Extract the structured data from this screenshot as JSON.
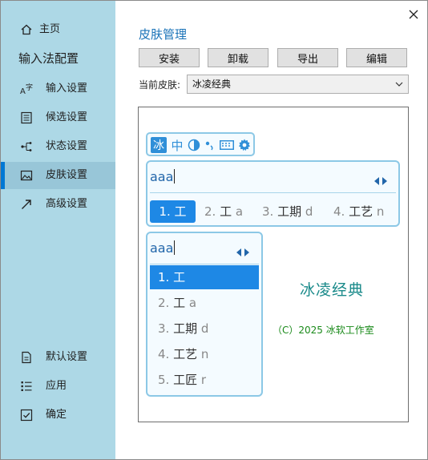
{
  "window": {
    "close_glyph": "✕"
  },
  "sidebar": {
    "home_label": "主页",
    "section_title": "输入法配置",
    "items": [
      {
        "label": "输入设置",
        "icon": "input-settings-icon"
      },
      {
        "label": "候选设置",
        "icon": "candidate-settings-icon"
      },
      {
        "label": "状态设置",
        "icon": "status-settings-icon"
      },
      {
        "label": "皮肤设置",
        "icon": "skin-settings-icon",
        "active": true
      },
      {
        "label": "高级设置",
        "icon": "advanced-settings-icon"
      }
    ],
    "bottom_items": [
      {
        "label": "默认设置",
        "icon": "default-settings-icon"
      },
      {
        "label": "应用",
        "icon": "apply-icon"
      },
      {
        "label": "确定",
        "icon": "confirm-icon"
      }
    ],
    "bg_color": "#add8e6",
    "accent_color": "#0078d4"
  },
  "main": {
    "title": "皮肤管理",
    "buttons": {
      "install": "安装",
      "uninstall": "卸载",
      "export": "导出",
      "edit": "编辑"
    },
    "current_skin_label": "当前皮肤:",
    "current_skin_value": "冰凌经典"
  },
  "preview": {
    "statusbar": {
      "logo_char": "冰",
      "mode_char": "中"
    },
    "horizontal": {
      "composition": "aaa",
      "candidates": [
        {
          "num": "1.",
          "text": "工",
          "code": ""
        },
        {
          "num": "2.",
          "text": "工",
          "code": "a"
        },
        {
          "num": "3.",
          "text": "工期",
          "code": "d"
        },
        {
          "num": "4.",
          "text": "工艺",
          "code": "n"
        }
      ]
    },
    "vertical": {
      "composition": "aaa",
      "candidates": [
        {
          "num": "1.",
          "text": "工",
          "code": ""
        },
        {
          "num": "2.",
          "text": "工",
          "code": "a"
        },
        {
          "num": "3.",
          "text": "工期",
          "code": "d"
        },
        {
          "num": "4.",
          "text": "工艺",
          "code": "n"
        },
        {
          "num": "5.",
          "text": "工匠",
          "code": "r"
        }
      ]
    },
    "skin_name": "冰凌经典",
    "copyright": "（C）2025 冰软工作室",
    "highlight_color": "#1e88e5",
    "border_color": "#8cc8e6"
  }
}
